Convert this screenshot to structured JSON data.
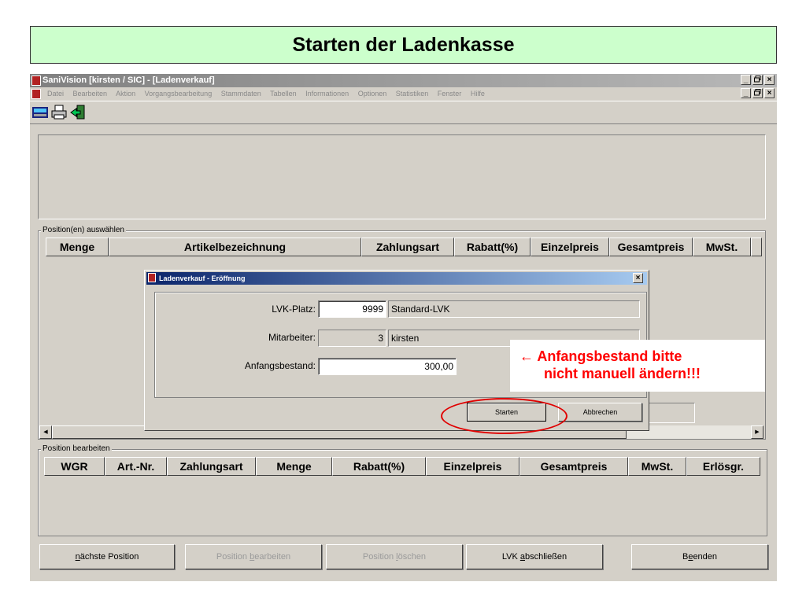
{
  "slide_title": "Starten der Ladenkasse",
  "window": {
    "title": "SaniVision  [kirsten / SIC] - [Ladenverkauf]",
    "controls": [
      "_",
      "°",
      "×"
    ],
    "menu": [
      "Datei",
      "Bearbeiten",
      "Aktion",
      "Vorgangsbearbeitung",
      "Stammdaten",
      "Tabellen",
      "Informationen",
      "Optionen",
      "Statistiken",
      "Fenster",
      "Hilfe"
    ]
  },
  "position_select": {
    "legend": "Position(en) auswählen",
    "columns": [
      "Menge",
      "Artikelbezeichnung",
      "Zahlungsart",
      "Rabatt(%)",
      "Einzelpreis",
      "Gesamtpreis",
      "MwSt."
    ]
  },
  "position_edit": {
    "legend": "Position bearbeiten",
    "columns": [
      "WGR",
      "Art.-Nr.",
      "Zahlungsart",
      "Menge",
      "Rabatt(%)",
      "Einzelpreis",
      "Gesamtpreis",
      "MwSt.",
      "Erlösgr."
    ]
  },
  "buttons": {
    "next": {
      "pre": "",
      "u": "n",
      "post": "ächste Position"
    },
    "edit": {
      "pre": "Position ",
      "u": "b",
      "post": "earbeiten"
    },
    "delete": {
      "pre": "Position ",
      "u": "l",
      "post": "öschen"
    },
    "close_lvk": {
      "pre": "LVK ",
      "u": "a",
      "post": "bschließen"
    },
    "quit": {
      "pre": "B",
      "u": "e",
      "post": "enden"
    }
  },
  "dialog": {
    "title": "Ladenverkauf - Eröffnung",
    "close": "×",
    "lvk_label": "LVK-Platz:",
    "lvk_number": "9999",
    "lvk_name": "Standard-LVK",
    "employee_label": "Mitarbeiter:",
    "employee_number": "3",
    "employee_name": "kirsten",
    "opening_label": "Anfangsbestand:",
    "opening_value": "300,00",
    "start_button": "Starten",
    "cancel_button": "Abbrechen"
  },
  "annotation": {
    "line1": "← Anfangsbestand bitte",
    "line2": "nicht manuell  ändern!!!",
    "color": "#ff0000"
  },
  "scrollbar": {
    "left_arrow": "◀",
    "right_arrow": "▶"
  },
  "icons": [
    "register-icon",
    "printer-icon",
    "exit-door-icon"
  ]
}
